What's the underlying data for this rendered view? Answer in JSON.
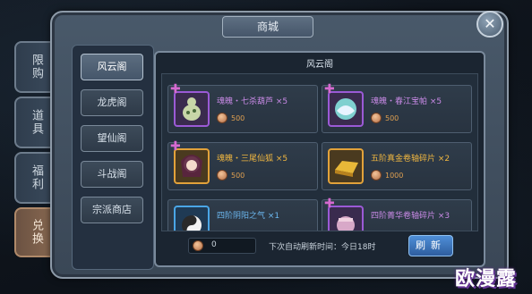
{
  "title": "商城",
  "close_icon": "close-icon",
  "side_tabs": [
    {
      "label": "限购",
      "active": false
    },
    {
      "label": "道具",
      "active": false
    },
    {
      "label": "福利",
      "active": false
    },
    {
      "label": "兑换",
      "active": true
    }
  ],
  "nav": [
    {
      "label": "风云阁",
      "active": true
    },
    {
      "label": "龙虎阁",
      "active": false
    },
    {
      "label": "望仙阁",
      "active": false
    },
    {
      "label": "斗战阁",
      "active": false
    },
    {
      "label": "宗派商店",
      "active": false
    }
  ],
  "panel_title": "风云阁",
  "items": [
    {
      "name": "魂魄・七杀葫芦 ×5",
      "price": "500",
      "rarity": "purple"
    },
    {
      "name": "魂魄・春江宝帕 ×5",
      "price": "500",
      "rarity": "purple"
    },
    {
      "name": "魂魄・三尾仙狐 ×5",
      "price": "500",
      "rarity": "gold"
    },
    {
      "name": "五阶真金卷轴碎片 ×2",
      "price": "1000",
      "rarity": "gold"
    },
    {
      "name": "四阶阴阳之气 ×1",
      "price": "",
      "rarity": "blue"
    },
    {
      "name": "四阶菁华卷轴碎片 ×3",
      "price": "",
      "rarity": "purple"
    }
  ],
  "currency_value": "0",
  "refresh_text": "下次自动刷新时间：今日18时",
  "refresh_button": "刷新",
  "watermark": "欧漫露"
}
